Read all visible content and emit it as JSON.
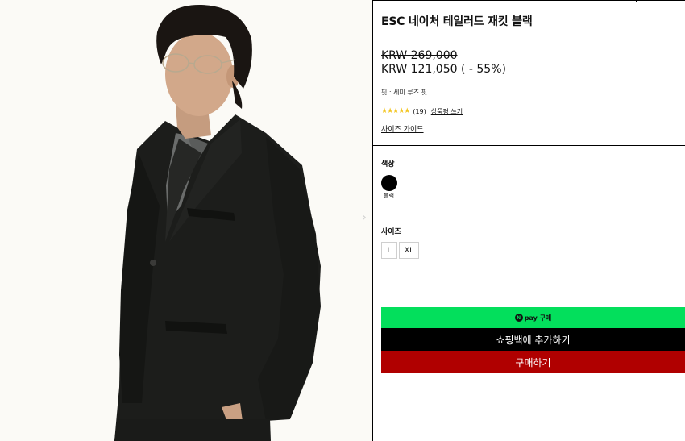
{
  "product": {
    "title": "ESC 네이처 테일러드 재킷 블랙",
    "price_original": "KRW 269,000",
    "price_sale": "KRW 121,050 ( - 55%)",
    "fit": "핏 : 세미 루즈 핏",
    "rating_stars": "★★★★★",
    "review_count": "(19)",
    "review_link": "상품평 쓰기",
    "size_guide": "사이즈 가이드"
  },
  "options": {
    "color_label": "색상",
    "color_name": "블랙",
    "color_hex": "#000000",
    "size_label": "사이즈",
    "sizes": [
      "L",
      "XL"
    ]
  },
  "actions": {
    "npay_icon": "N",
    "npay_label": "pay 구매",
    "add_to_bag": "쇼핑백에 추가하기",
    "buy_now": "구매하기"
  },
  "gallery": {
    "next_icon": "›"
  },
  "colors": {
    "npay_green": "#03df5c",
    "buy_red": "#b00000",
    "star_yellow": "#f3c623"
  }
}
